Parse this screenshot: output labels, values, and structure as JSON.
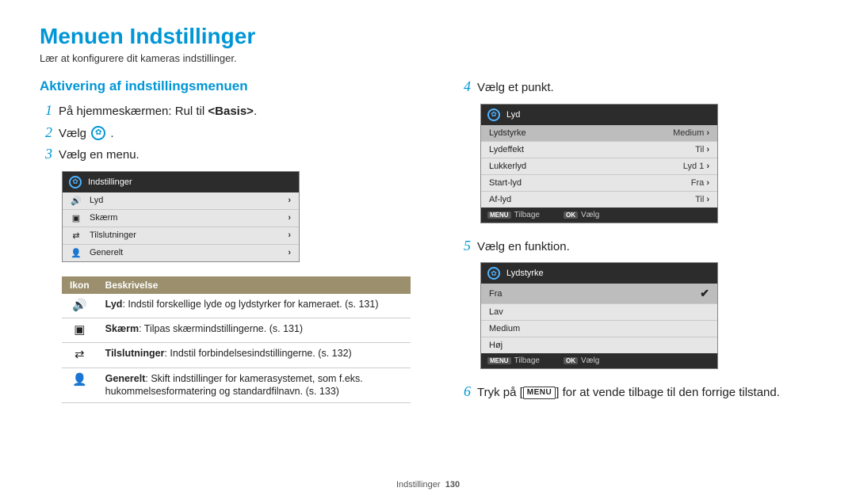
{
  "page_title": "Menuen Indstillinger",
  "page_subtitle": "Lær at konfigurere dit kameras indstillinger.",
  "section_heading": "Aktivering af indstillingsmenuen",
  "steps": {
    "s1_num": "1",
    "s1_text_a": "På hjemmeskærmen: Rul til ",
    "s1_text_b": "<Basis>",
    "s1_text_c": ".",
    "s2_num": "2",
    "s2_text": "Vælg ",
    "s2_text_end": " .",
    "s3_num": "3",
    "s3_text": "Vælg en menu.",
    "s4_num": "4",
    "s4_text": "Vælg et punkt.",
    "s5_num": "5",
    "s5_text": "Vælg en funktion.",
    "s6_num": "6",
    "s6_text_a": "Tryk på [",
    "s6_menu": "MENU",
    "s6_text_b": "] for at vende tilbage til den forrige tilstand."
  },
  "cam1": {
    "title": "Indstillinger",
    "rows": [
      {
        "icon": "🔊",
        "label": "Lyd"
      },
      {
        "icon": "▣",
        "label": "Skærm"
      },
      {
        "icon": "⇄",
        "label": "Tilslutninger"
      },
      {
        "icon": "👤",
        "label": "Generelt"
      }
    ]
  },
  "cam2": {
    "title": "Lyd",
    "rows": [
      {
        "label": "Lydstyrke",
        "value": "Medium",
        "highlight": true
      },
      {
        "label": "Lydeffekt",
        "value": "Til"
      },
      {
        "label": "Lukkerlyd",
        "value": "Lyd 1"
      },
      {
        "label": "Start-lyd",
        "value": "Fra"
      },
      {
        "label": "Af-lyd",
        "value": "Til"
      }
    ],
    "footer_back_label": "Tilbage",
    "footer_back_btn": "MENU",
    "footer_ok_label": "Vælg",
    "footer_ok_btn": "OK"
  },
  "cam3": {
    "title": "Lydstyrke",
    "rows": [
      {
        "label": "Fra",
        "selected": true
      },
      {
        "label": "Lav"
      },
      {
        "label": "Medium"
      },
      {
        "label": "Høj"
      }
    ],
    "footer_back_label": "Tilbage",
    "footer_back_btn": "MENU",
    "footer_ok_label": "Vælg",
    "footer_ok_btn": "OK"
  },
  "desc_table": {
    "header_icon": "Ikon",
    "header_desc": "Beskrivelse",
    "rows": [
      {
        "icon": "🔊",
        "bold": "Lyd",
        "text": ": Indstil forskellige lyde og lydstyrker for kameraet. (s. 131)"
      },
      {
        "icon": "▣",
        "bold": "Skærm",
        "text": ": Tilpas skærmindstillingerne. (s. 131)"
      },
      {
        "icon": "⇄",
        "bold": "Tilslutninger",
        "text": ": Indstil forbindelsesindstillingerne. (s. 132)"
      },
      {
        "icon": "👤",
        "bold": "Generelt",
        "text": ": Skift indstillinger for kamerasystemet, som f.eks. hukommelsesformatering og standardfilnavn. (s. 133)"
      }
    ]
  },
  "footer": {
    "section": "Indstillinger",
    "page": "130"
  }
}
